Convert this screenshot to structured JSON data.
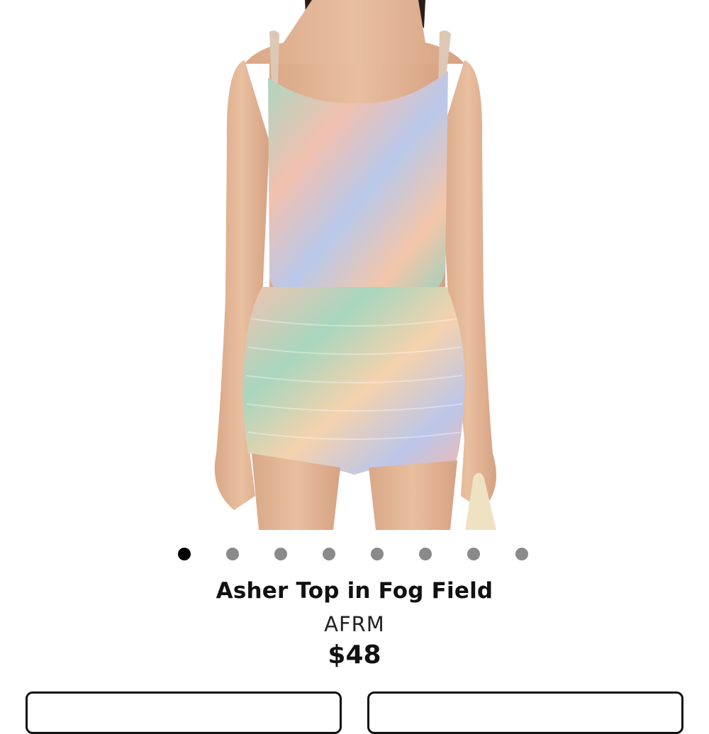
{
  "product": {
    "title": "Asher Top in Fog Field",
    "brand": "AFRM",
    "price": "$48"
  },
  "gallery": {
    "total_images": 8,
    "active_index": 0
  },
  "colors": {
    "dot_active": "#000000",
    "dot_inactive": "#8a8a8a",
    "text": "#111111"
  }
}
